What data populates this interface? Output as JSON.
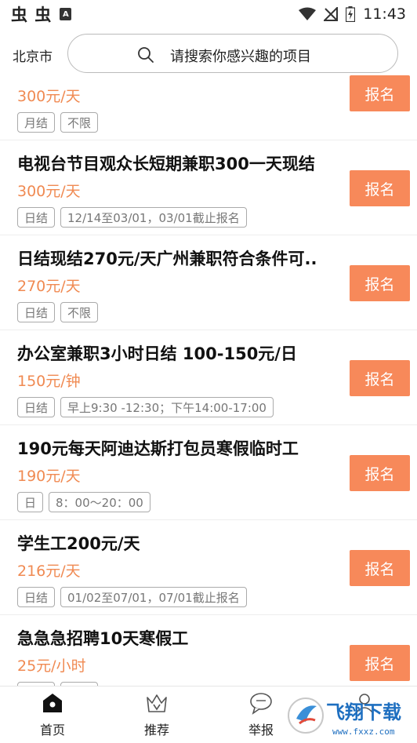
{
  "statusbar": {
    "app_icons": "虫 虫",
    "box_icon_letter": "A",
    "time": "11:43"
  },
  "header": {
    "city": "北京市",
    "search_placeholder": "请搜索你感兴趣的项目"
  },
  "jobs": [
    {
      "title": "",
      "price": "300元/天",
      "tags": [
        "月结",
        "不限"
      ],
      "apply": "报名"
    },
    {
      "title": "电视台节目观众长短期兼职300一天现结",
      "price": "300元/天",
      "tags": [
        "日结",
        "12/14至03/01，03/01截止报名"
      ],
      "apply": "报名"
    },
    {
      "title": "日结现结270元/天广州兼职符合条件可..",
      "price": "270元/天",
      "tags": [
        "日结",
        "不限"
      ],
      "apply": "报名"
    },
    {
      "title": "办公室兼职3小时日结 100-150元/日",
      "price": "150元/钟",
      "tags": [
        "日结",
        "早上9:30 -12:30；下午14:00-17:00"
      ],
      "apply": "报名"
    },
    {
      "title": " 190元每天阿迪达斯打包员寒假临时工",
      "price": "190元/天",
      "tags": [
        "日",
        "8：00～20：00"
      ],
      "apply": "报名"
    },
    {
      "title": "学生工200元/天",
      "price": "216元/天",
      "tags": [
        "日结",
        "01/02至07/01，07/01截止报名"
      ],
      "apply": "报名"
    },
    {
      "title": "急急急招聘10天寒假工",
      "price": "25元/小时",
      "tags": [
        "日结",
        "不限"
      ],
      "apply": "报名"
    }
  ],
  "bottom_nav": [
    {
      "label": "首页",
      "icon": "home-icon",
      "active": true
    },
    {
      "label": "推荐",
      "icon": "crown-icon",
      "active": false
    },
    {
      "label": "举报",
      "icon": "chat-bubble-icon",
      "active": false
    },
    {
      "label": "",
      "icon": "user-icon",
      "active": false
    }
  ],
  "watermark": {
    "text": "飞翔下载",
    "url_text": "www.fxxz.com"
  },
  "colors": {
    "accent": "#f7895a",
    "price": "#f08a52"
  }
}
